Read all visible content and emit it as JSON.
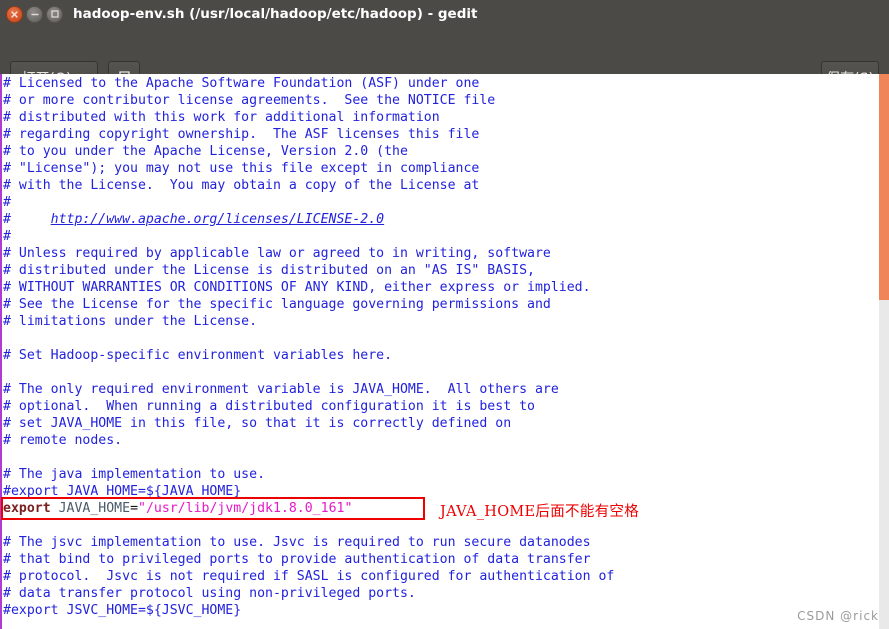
{
  "window": {
    "title": "hadoop-env.sh (/usr/local/hadoop/etc/hadoop) - gedit",
    "buttons": {
      "close": "close-icon",
      "minimize": "minimize-icon",
      "maximize": "maximize-icon"
    }
  },
  "toolbar": {
    "open_label": "打开(O)",
    "new_icon": "new-document-icon",
    "save_label": "保存(S)"
  },
  "colors": {
    "titlebar_bg": "#4c4a47",
    "comment": "#2222dd",
    "keyword": "#7a1f1f",
    "string": "#e819c8",
    "variable": "#4a5a6a",
    "annotation": "#ee0000",
    "scrollbar_thumb": "#ef8558",
    "left_rail": "#b03bd0"
  },
  "editor": {
    "filename": "hadoop-env.sh",
    "lines": [
      {
        "type": "comment",
        "text": "# Licensed to the Apache Software Foundation (ASF) under one"
      },
      {
        "type": "comment",
        "text": "# or more contributor license agreements.  See the NOTICE file"
      },
      {
        "type": "comment",
        "text": "# distributed with this work for additional information"
      },
      {
        "type": "comment",
        "text": "# regarding copyright ownership.  The ASF licenses this file"
      },
      {
        "type": "comment",
        "text": "# to you under the Apache License, Version 2.0 (the"
      },
      {
        "type": "comment",
        "text": "# \"License\"); you may not use this file except in compliance"
      },
      {
        "type": "comment",
        "text": "# with the License.  You may obtain a copy of the License at"
      },
      {
        "type": "comment",
        "text": "#"
      },
      {
        "type": "link",
        "prefix": "#     ",
        "text": "http://www.apache.org/licenses/LICENSE-2.0"
      },
      {
        "type": "comment",
        "text": "#"
      },
      {
        "type": "comment",
        "text": "# Unless required by applicable law or agreed to in writing, software"
      },
      {
        "type": "comment",
        "text": "# distributed under the License is distributed on an \"AS IS\" BASIS,"
      },
      {
        "type": "comment",
        "text": "# WITHOUT WARRANTIES OR CONDITIONS OF ANY KIND, either express or implied."
      },
      {
        "type": "comment",
        "text": "# See the License for the specific language governing permissions and"
      },
      {
        "type": "comment",
        "text": "# limitations under the License."
      },
      {
        "type": "blank",
        "text": ""
      },
      {
        "type": "comment",
        "text": "# Set Hadoop-specific environment variables here."
      },
      {
        "type": "blank",
        "text": ""
      },
      {
        "type": "comment",
        "text": "# The only required environment variable is JAVA_HOME.  All others are"
      },
      {
        "type": "comment",
        "text": "# optional.  When running a distributed configuration it is best to"
      },
      {
        "type": "comment",
        "text": "# set JAVA_HOME in this file, so that it is correctly defined on"
      },
      {
        "type": "comment",
        "text": "# remote nodes."
      },
      {
        "type": "blank",
        "text": ""
      },
      {
        "type": "comment",
        "text": "# The java implementation to use."
      },
      {
        "type": "comment",
        "text": "#export JAVA_HOME=${JAVA_HOME}"
      },
      {
        "type": "export",
        "keyword": "export",
        "space": " ",
        "variable": "JAVA_HOME",
        "operator": "=",
        "value": "\"/usr/lib/jvm/jdk1.8.0_161\"",
        "text": "export JAVA_HOME=\"/usr/lib/jvm/jdk1.8.0_161\""
      },
      {
        "type": "blank",
        "text": ""
      },
      {
        "type": "comment",
        "text": "# The jsvc implementation to use. Jsvc is required to run secure datanodes"
      },
      {
        "type": "comment",
        "text": "# that bind to privileged ports to provide authentication of data transfer"
      },
      {
        "type": "comment",
        "text": "# protocol.  Jsvc is not required if SASL is configured for authentication of"
      },
      {
        "type": "comment",
        "text": "# data transfer protocol using non-privileged ports."
      },
      {
        "type": "comment",
        "text": "#export JSVC_HOME=${JSVC_HOME}"
      }
    ]
  },
  "annotation": {
    "text": "JAVA_HOME后面不能有空格"
  },
  "scrollbar": {
    "name": "vertical-scrollbar"
  },
  "watermark": {
    "text": "CSDN @rick"
  }
}
